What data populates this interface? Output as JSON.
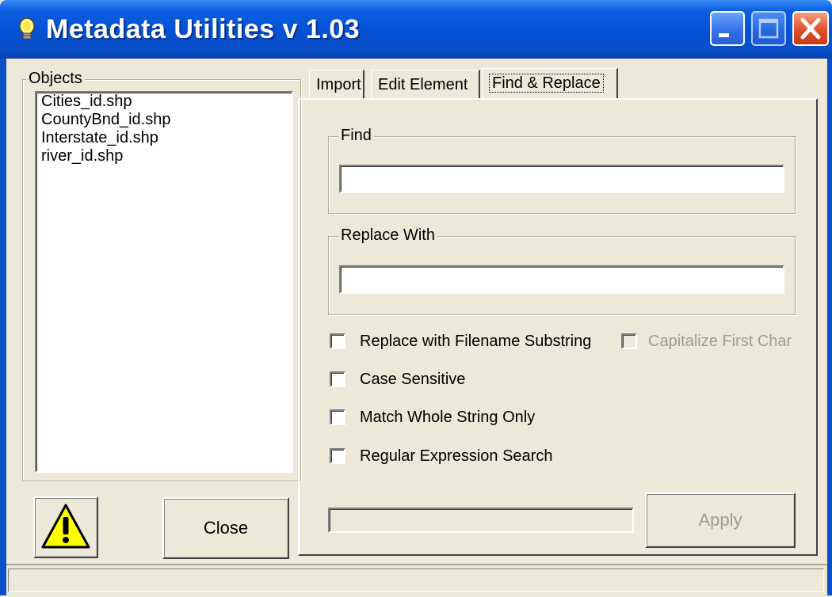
{
  "window": {
    "title": "Metadata Utilities v 1.03",
    "icon": "lightbulb-icon",
    "controls": {
      "minimize": "minimize-icon",
      "maximize": "maximize-icon",
      "close": "close-icon"
    },
    "accent": "#0552d6"
  },
  "objects": {
    "label": "Objects",
    "items": [
      "Cities_id.shp",
      "CountyBnd_id.shp",
      "Interstate_id.shp",
      "river_id.shp"
    ]
  },
  "buttons": {
    "warning_icon": "warning-icon",
    "close_label": "Close",
    "apply_label": "Apply"
  },
  "tabs": [
    {
      "label": "Import",
      "active": false
    },
    {
      "label": "Edit Element",
      "active": false
    },
    {
      "label": "Find & Replace",
      "active": true
    }
  ],
  "find": {
    "label": "Find",
    "value": ""
  },
  "replace": {
    "label": "Replace With",
    "value": ""
  },
  "options": {
    "filename_substring": {
      "label": "Replace with Filename Substring",
      "checked": false
    },
    "capitalize_first": {
      "label": "Capitalize First Char",
      "checked": false,
      "disabled": true
    },
    "case_sensitive": {
      "label": "Case Sensitive",
      "checked": false
    },
    "match_whole": {
      "label": "Match Whole String Only",
      "checked": false
    },
    "regex": {
      "label": "Regular Expression Search",
      "checked": false
    }
  },
  "progress": {
    "value": 0
  },
  "status": {
    "text": ""
  }
}
